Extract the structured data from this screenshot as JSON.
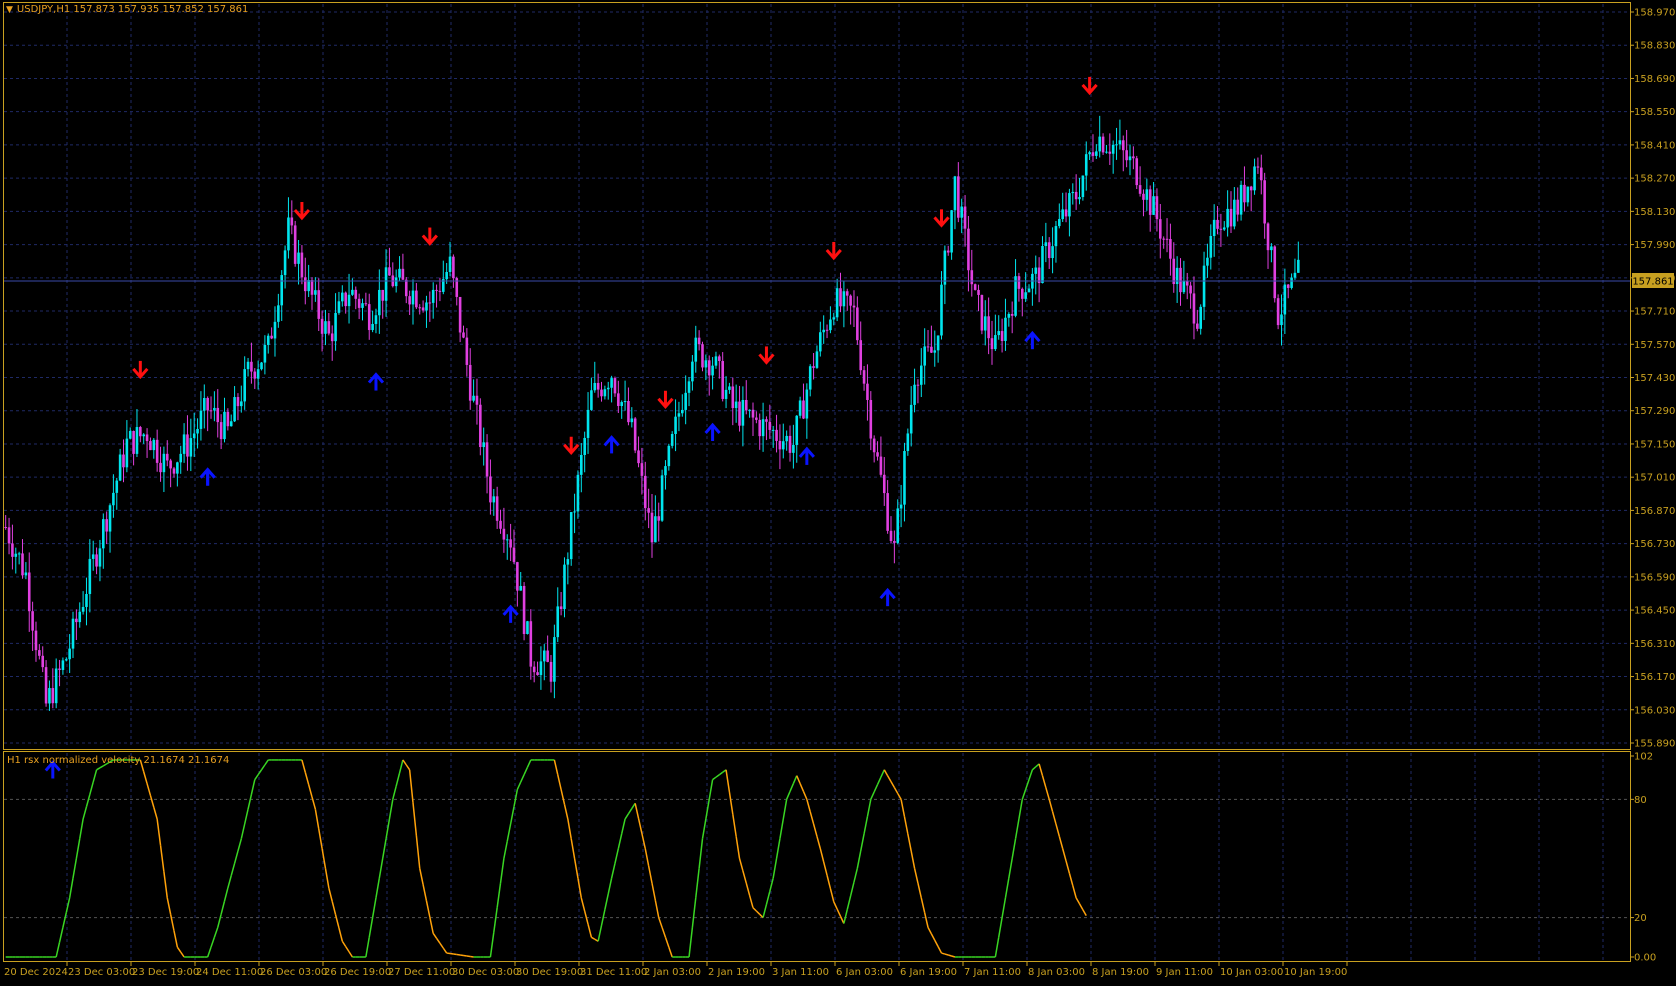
{
  "header": {
    "symbol_info": "USDJPY,H1  157.873 157.935 157.852 157.861"
  },
  "indicator": {
    "label": "H1 rsx normalized velocity 21.1674 21.1674"
  },
  "colors": {
    "background": "#000000",
    "frame": "#c8a020",
    "grid": "#1f2a66",
    "bull_candle": "#00e5ee",
    "bear_candle": "#e040e0",
    "buy_arrow": "#0a14ff",
    "sell_arrow": "#ff1010",
    "price_line": "#3a4aa8",
    "rsx_up": "#39d623",
    "rsx_down": "#ffa20a",
    "axis_text": "#c8a020",
    "price_tag_bg": "#c8a020"
  },
  "price_axis": {
    "labels": [
      "158.970",
      "158.830",
      "158.690",
      "158.550",
      "158.410",
      "158.270",
      "158.130",
      "157.990",
      "157.850",
      "157.710",
      "157.570",
      "157.430",
      "157.290",
      "157.150",
      "157.010",
      "156.870",
      "156.730",
      "156.590",
      "156.450",
      "156.310",
      "156.170",
      "156.030",
      "155.890"
    ],
    "current": "157.861"
  },
  "indicator_axis": {
    "labels": [
      "102",
      "80",
      "20",
      "0.00"
    ]
  },
  "time_axis": {
    "labels": [
      "20 Dec 2024",
      "23 Dec 03:00",
      "23 Dec 19:00",
      "24 Dec 11:00",
      "26 Dec 03:00",
      "26 Dec 19:00",
      "27 Dec 11:00",
      "30 Dec 03:00",
      "30 Dec 19:00",
      "31 Dec 11:00",
      "2 Jan 03:00",
      "2 Jan 19:00",
      "3 Jan 11:00",
      "6 Jan 03:00",
      "6 Jan 19:00",
      "7 Jan 11:00",
      "8 Jan 03:00",
      "8 Jan 19:00",
      "9 Jan 11:00",
      "10 Jan 03:00",
      "10 Jan 19:00"
    ]
  },
  "chart_data": {
    "type": "candlestick",
    "symbol": "USDJPY",
    "timeframe": "H1",
    "ohlc_header": {
      "open": 157.873,
      "high": 157.935,
      "low": 157.852,
      "close": 157.861
    },
    "ylim": [
      155.89,
      158.97
    ],
    "close_path": [
      [
        0,
        156.8
      ],
      [
        6,
        156.6
      ],
      [
        12,
        156.05
      ],
      [
        18,
        156.25
      ],
      [
        24,
        156.55
      ],
      [
        30,
        156.85
      ],
      [
        36,
        157.15
      ],
      [
        42,
        157.2
      ],
      [
        48,
        157.05
      ],
      [
        54,
        157.15
      ],
      [
        60,
        157.3
      ],
      [
        66,
        157.2
      ],
      [
        72,
        157.45
      ],
      [
        78,
        157.55
      ],
      [
        84,
        158.05
      ],
      [
        90,
        157.8
      ],
      [
        96,
        157.6
      ],
      [
        102,
        157.8
      ],
      [
        108,
        157.7
      ],
      [
        114,
        157.85
      ],
      [
        120,
        157.8
      ],
      [
        126,
        157.75
      ],
      [
        132,
        157.9
      ],
      [
        138,
        157.4
      ],
      [
        144,
        156.95
      ],
      [
        150,
        156.75
      ],
      [
        156,
        156.25
      ],
      [
        162,
        156.2
      ],
      [
        168,
        156.8
      ],
      [
        174,
        157.35
      ],
      [
        180,
        157.45
      ],
      [
        186,
        157.2
      ],
      [
        192,
        156.75
      ],
      [
        198,
        157.15
      ],
      [
        204,
        157.55
      ],
      [
        210,
        157.5
      ],
      [
        216,
        157.3
      ],
      [
        222,
        157.25
      ],
      [
        228,
        157.2
      ],
      [
        234,
        157.15
      ],
      [
        240,
        157.5
      ],
      [
        246,
        157.75
      ],
      [
        252,
        157.7
      ],
      [
        258,
        157.15
      ],
      [
        264,
        156.7
      ],
      [
        270,
        157.45
      ],
      [
        276,
        157.55
      ],
      [
        282,
        158.25
      ],
      [
        288,
        157.75
      ],
      [
        294,
        157.55
      ],
      [
        300,
        157.8
      ],
      [
        306,
        157.85
      ],
      [
        312,
        158.05
      ],
      [
        318,
        158.2
      ],
      [
        324,
        158.45
      ],
      [
        330,
        158.4
      ],
      [
        336,
        158.3
      ],
      [
        342,
        158.1
      ],
      [
        348,
        157.85
      ],
      [
        354,
        157.7
      ],
      [
        360,
        158.1
      ],
      [
        366,
        158.15
      ],
      [
        372,
        158.35
      ],
      [
        378,
        157.7
      ],
      [
        384,
        157.86
      ]
    ],
    "buy_signals": [
      "21 Dec",
      "24 Dec",
      "24 Dec",
      "27 Dec",
      "31 Dec",
      "2 Jan",
      "3 Jan",
      "6 Jan",
      "7 Jan",
      "9 Jan"
    ],
    "sell_signals": [
      "23 Dec",
      "26 Dec",
      "30 Dec",
      "2 Jan",
      "3 Jan",
      "6 Jan",
      "7 Jan",
      "8 Jan",
      "10 Jan"
    ],
    "indicator": {
      "name": "rsx normalized velocity",
      "ylim": [
        0,
        102
      ],
      "levels": [
        80,
        20
      ],
      "last_value": 21.1674,
      "path": [
        [
          0,
          0
        ],
        [
          15,
          0
        ],
        [
          19,
          30
        ],
        [
          23,
          70
        ],
        [
          27,
          95
        ],
        [
          32,
          100
        ],
        [
          40,
          100
        ],
        [
          45,
          70
        ],
        [
          48,
          30
        ],
        [
          51,
          5
        ],
        [
          53,
          0
        ],
        [
          60,
          0
        ],
        [
          63,
          15
        ],
        [
          66,
          35
        ],
        [
          70,
          60
        ],
        [
          74,
          90
        ],
        [
          78,
          100
        ],
        [
          88,
          100
        ],
        [
          92,
          75
        ],
        [
          96,
          35
        ],
        [
          100,
          8
        ],
        [
          103,
          0
        ],
        [
          107,
          0
        ],
        [
          111,
          40
        ],
        [
          115,
          80
        ],
        [
          118,
          100
        ],
        [
          120,
          95
        ],
        [
          123,
          45
        ],
        [
          127,
          12
        ],
        [
          131,
          2
        ],
        [
          139,
          0
        ],
        [
          144,
          0
        ],
        [
          148,
          50
        ],
        [
          152,
          85
        ],
        [
          156,
          100
        ],
        [
          163,
          100
        ],
        [
          167,
          70
        ],
        [
          171,
          30
        ],
        [
          174,
          10
        ],
        [
          176,
          8
        ],
        [
          180,
          40
        ],
        [
          184,
          70
        ],
        [
          187,
          78
        ],
        [
          190,
          55
        ],
        [
          194,
          20
        ],
        [
          198,
          0
        ],
        [
          203,
          0
        ],
        [
          207,
          60
        ],
        [
          210,
          90
        ],
        [
          214,
          95
        ],
        [
          218,
          50
        ],
        [
          222,
          25
        ],
        [
          225,
          20
        ],
        [
          228,
          40
        ],
        [
          232,
          80
        ],
        [
          235,
          92
        ],
        [
          238,
          80
        ],
        [
          242,
          55
        ],
        [
          246,
          28
        ],
        [
          249,
          17
        ],
        [
          253,
          45
        ],
        [
          257,
          80
        ],
        [
          261,
          95
        ],
        [
          266,
          80
        ],
        [
          270,
          45
        ],
        [
          274,
          15
        ],
        [
          278,
          2
        ],
        [
          282,
          0
        ],
        [
          294,
          0
        ],
        [
          298,
          40
        ],
        [
          302,
          80
        ],
        [
          305,
          95
        ],
        [
          307,
          98
        ],
        [
          310,
          80
        ],
        [
          314,
          55
        ],
        [
          318,
          30
        ],
        [
          321,
          21
        ]
      ]
    }
  }
}
